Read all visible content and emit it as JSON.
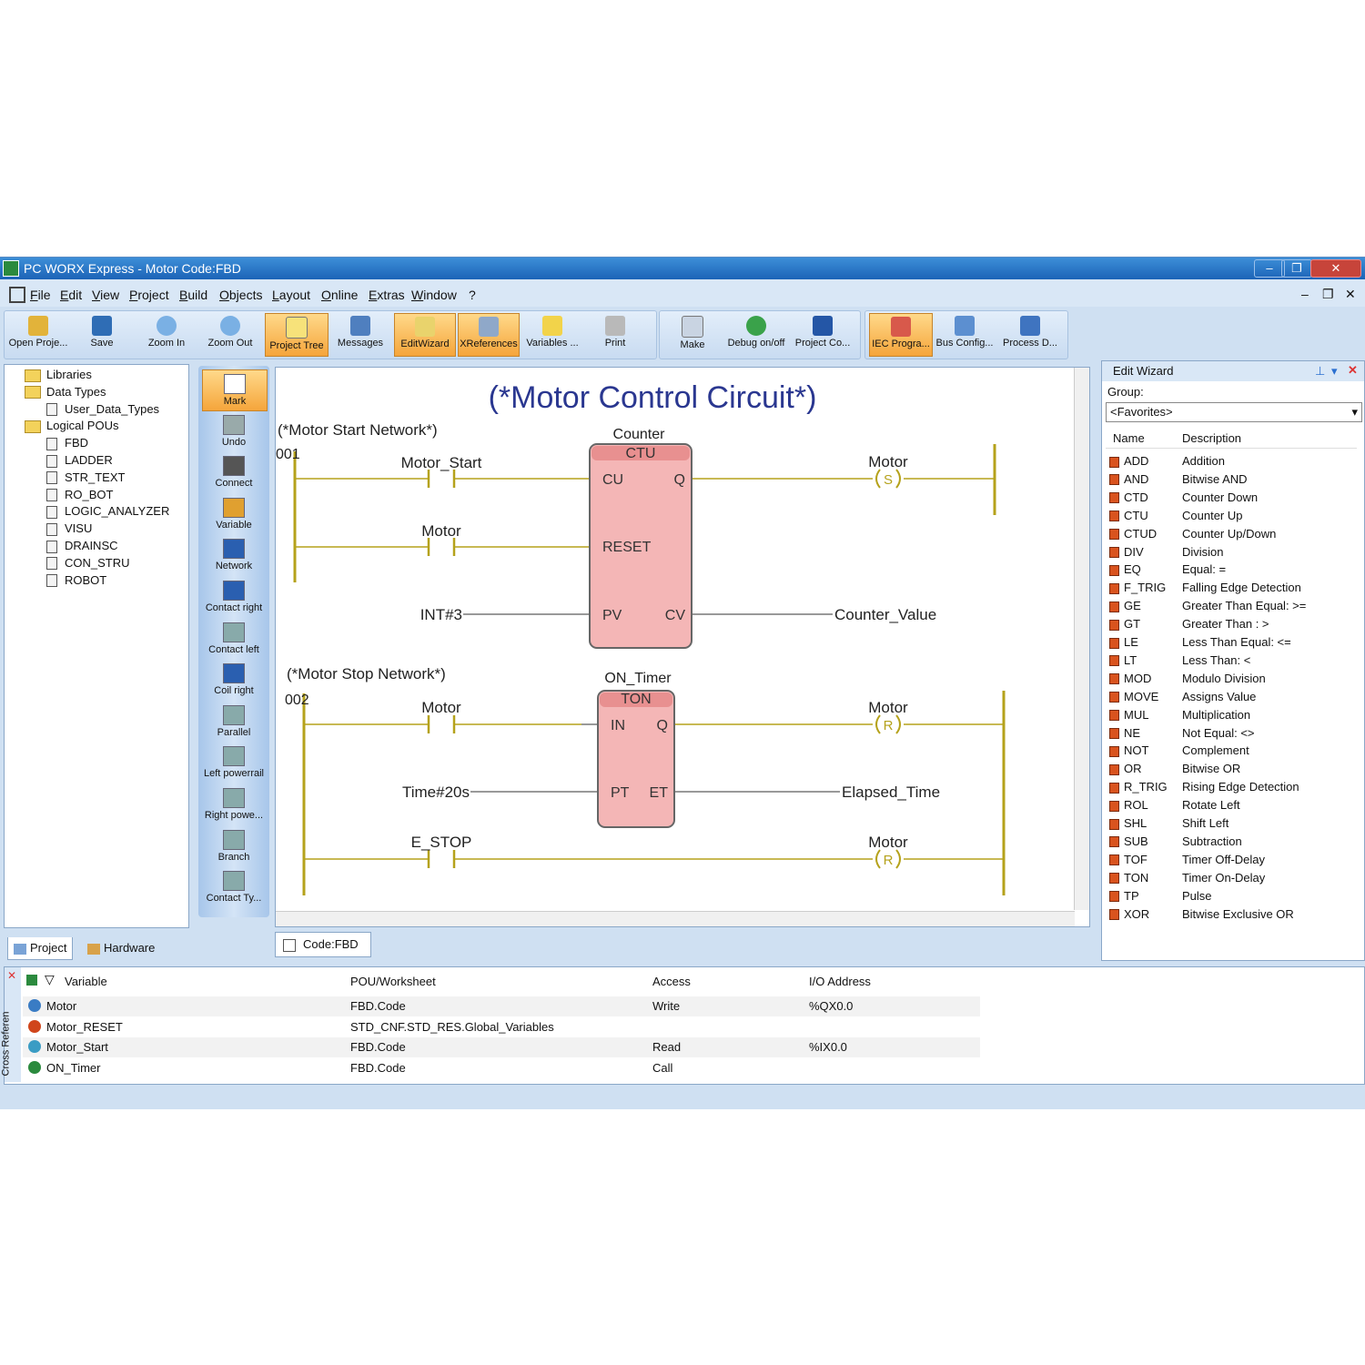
{
  "window": {
    "title": "PC WORX Express - Motor     Code:FBD",
    "min": "–",
    "max": "❐",
    "close": "✕"
  },
  "menu": [
    "File",
    "Edit",
    "View",
    "Project",
    "Build",
    "Objects",
    "Layout",
    "Online",
    "Extras",
    "Window",
    "?"
  ],
  "toolbar": [
    {
      "label": "Open Proje...",
      "icon": "open-project-icon",
      "active": false
    },
    {
      "label": "Save",
      "icon": "save-icon",
      "active": false
    },
    {
      "label": "Zoom In",
      "icon": "zoom-in-icon",
      "active": false
    },
    {
      "label": "Zoom Out",
      "icon": "zoom-out-icon",
      "active": false
    },
    {
      "label": "Project Tree",
      "icon": "project-tree-icon",
      "active": true
    },
    {
      "label": "Messages",
      "icon": "messages-icon",
      "active": false
    },
    {
      "label": "EditWizard",
      "icon": "edit-wizard-icon",
      "active": true
    },
    {
      "label": "XReferences",
      "icon": "xreferences-icon",
      "active": true
    },
    {
      "label": "Variables ...",
      "icon": "variables-icon",
      "active": false
    },
    {
      "label": "Print",
      "icon": "print-icon",
      "active": false
    },
    {
      "label": "Make",
      "icon": "make-icon",
      "active": false
    },
    {
      "label": "Debug on/off",
      "icon": "debug-icon",
      "active": false
    },
    {
      "label": "Project Co...",
      "icon": "project-control-icon",
      "active": false
    },
    {
      "label": "IEC Progra...",
      "icon": "iec-programming-icon",
      "active": true
    },
    {
      "label": "Bus Config...",
      "icon": "bus-config-icon",
      "active": false
    },
    {
      "label": "Process D...",
      "icon": "process-data-icon",
      "active": false
    }
  ],
  "tree": [
    {
      "label": "Libraries",
      "type": "folder",
      "level": 0
    },
    {
      "label": "Data Types",
      "type": "folder",
      "level": 0
    },
    {
      "label": "User_Data_Types",
      "type": "pou",
      "level": 2
    },
    {
      "label": "Logical POUs",
      "type": "folder",
      "level": 0
    },
    {
      "label": "FBD",
      "type": "pou",
      "level": 1
    },
    {
      "label": "LADDER",
      "type": "pou",
      "level": 1
    },
    {
      "label": "STR_TEXT",
      "type": "pou",
      "level": 1
    },
    {
      "label": "RO_BOT",
      "type": "pou",
      "level": 1
    },
    {
      "label": "LOGIC_ANALYZER",
      "type": "pou",
      "level": 1
    },
    {
      "label": "VISU",
      "type": "pou",
      "level": 1
    },
    {
      "label": "DRAINSC",
      "type": "pou",
      "level": 1
    },
    {
      "label": "CON_STRU",
      "type": "pou",
      "level": 1
    },
    {
      "label": "ROBOT",
      "type": "pou",
      "level": 1
    }
  ],
  "project_tabs": [
    "Project",
    "Hardware"
  ],
  "palette": [
    "Mark",
    "Undo",
    "Connect",
    "Variable",
    "Network",
    "Contact right",
    "Contact left",
    "Coil right",
    "Parallel",
    "Left powerrail",
    "Right powe...",
    "Branch",
    "Contact Ty..."
  ],
  "editor": {
    "title": "(*Motor Control Circuit*)",
    "tab": "Code:FBD",
    "net1": {
      "comment": "(*Motor Start Network*)",
      "number": "001",
      "contact1": "Motor_Start",
      "contact2": "Motor",
      "pv_in": "INT#3",
      "cv_out": "Counter_Value",
      "fb_instance": "Counter",
      "fb_type": "CTU",
      "pins": {
        "cu": "CU",
        "reset": "RESET",
        "pv": "PV",
        "q": "Q",
        "cv": "CV"
      },
      "coil": "Motor",
      "coil_mark": "S"
    },
    "net2": {
      "comment": "(*Motor Stop Network*)",
      "number": "002",
      "contact1": "Motor",
      "pt_in": "Time#20s",
      "et_out": "Elapsed_Time",
      "fb_instance": "ON_Timer",
      "fb_type": "TON",
      "pins": {
        "in": "IN",
        "pt": "PT",
        "q": "Q",
        "et": "ET"
      },
      "coil1": "Motor",
      "coil1_mark": "R",
      "contact_estop": "E_STOP",
      "coil2": "Motor",
      "coil2_mark": "R"
    }
  },
  "wizard": {
    "title": "Edit Wizard",
    "group_label": "Group:",
    "group_value": "<Favorites>",
    "col_name": "Name",
    "col_desc": "Description",
    "items": [
      {
        "name": "ADD",
        "desc": "Addition"
      },
      {
        "name": "AND",
        "desc": "Bitwise AND"
      },
      {
        "name": "CTD",
        "desc": "Counter Down"
      },
      {
        "name": "CTU",
        "desc": "Counter Up"
      },
      {
        "name": "CTUD",
        "desc": "Counter Up/Down"
      },
      {
        "name": "DIV",
        "desc": "Division"
      },
      {
        "name": "EQ",
        "desc": "Equal: ="
      },
      {
        "name": "F_TRIG",
        "desc": "Falling Edge Detection"
      },
      {
        "name": "GE",
        "desc": "Greater Than Equal: >="
      },
      {
        "name": "GT",
        "desc": "Greater Than : >"
      },
      {
        "name": "LE",
        "desc": "Less Than Equal: <="
      },
      {
        "name": "LT",
        "desc": "Less Than: <"
      },
      {
        "name": "MOD",
        "desc": "Modulo Division"
      },
      {
        "name": "MOVE",
        "desc": "Assigns Value"
      },
      {
        "name": "MUL",
        "desc": "Multiplication"
      },
      {
        "name": "NE",
        "desc": "Not Equal: <>"
      },
      {
        "name": "NOT",
        "desc": "Complement"
      },
      {
        "name": "OR",
        "desc": "Bitwise OR"
      },
      {
        "name": "R_TRIG",
        "desc": "Rising Edge Detection"
      },
      {
        "name": "ROL",
        "desc": "Rotate Left"
      },
      {
        "name": "SHL",
        "desc": "Shift Left"
      },
      {
        "name": "SUB",
        "desc": "Subtraction"
      },
      {
        "name": "TOF",
        "desc": "Timer Off-Delay"
      },
      {
        "name": "TON",
        "desc": "Timer On-Delay"
      },
      {
        "name": "TP",
        "desc": "Pulse"
      },
      {
        "name": "XOR",
        "desc": "Bitwise Exclusive OR"
      }
    ]
  },
  "xref": {
    "side_label": "Cross Referen",
    "headers": {
      "variable": "Variable",
      "pou": "POU/Worksheet",
      "access": "Access",
      "io": "I/O Address"
    },
    "rows": [
      {
        "variable": "Motor",
        "pou": "FBD.Code",
        "access": "Write",
        "io": "%QX0.0"
      },
      {
        "variable": "Motor_RESET",
        "pou": "STD_CNF.STD_RES.Global_Variables",
        "access": "",
        "io": ""
      },
      {
        "variable": "Motor_Start",
        "pou": "FBD.Code",
        "access": "Read",
        "io": "%IX0.0"
      },
      {
        "variable": "ON_Timer",
        "pou": "FBD.Code",
        "access": "Call",
        "io": ""
      }
    ]
  },
  "colors": {
    "rung": "#b5a21b",
    "fb_fill": "#f4b6b6",
    "fb_header": "#e89090",
    "title": "#2a3790",
    "active": "#f5a53b"
  }
}
